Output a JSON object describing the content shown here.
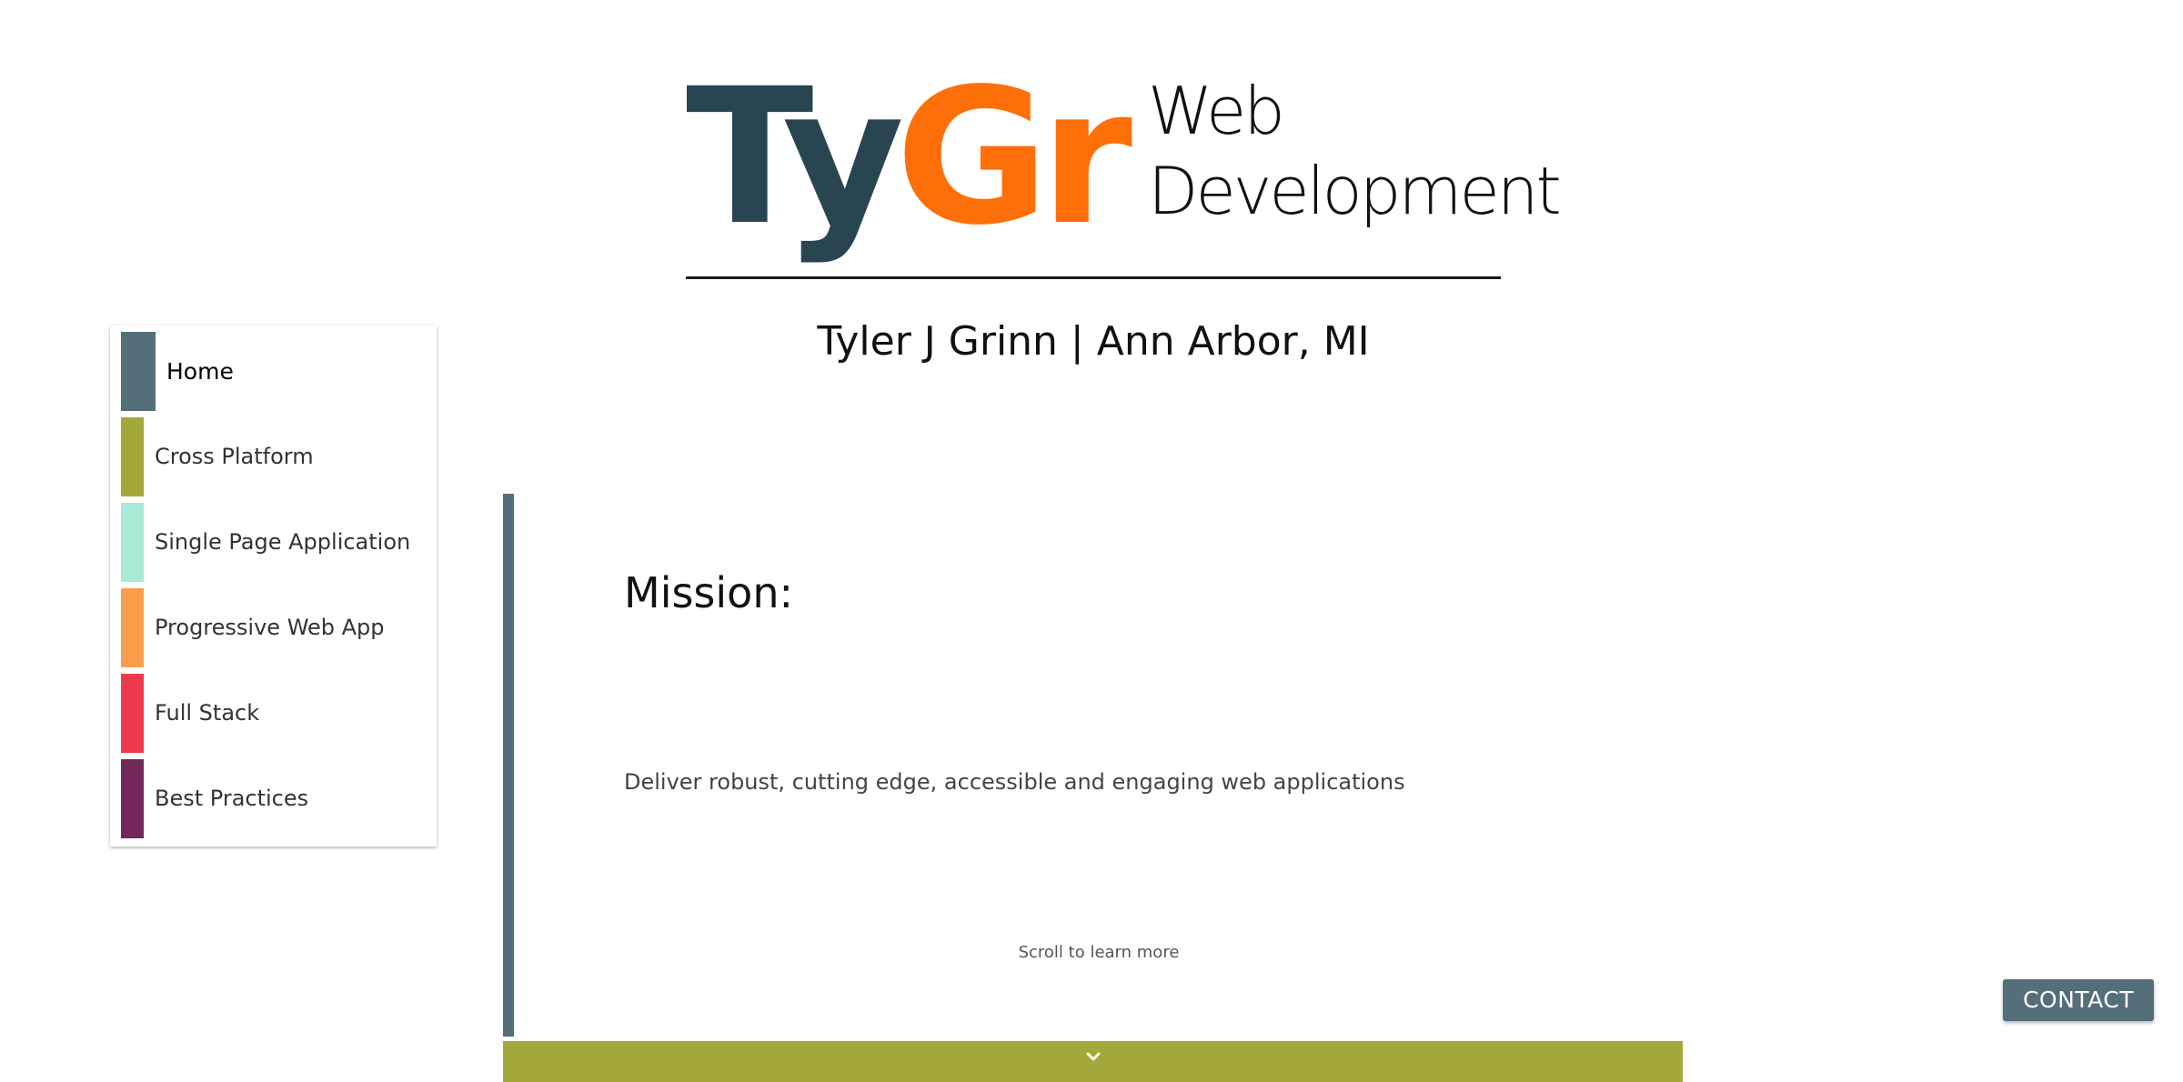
{
  "header": {
    "logo_part1": "Ty",
    "logo_part2": "Gr",
    "tagline_line1": "Web",
    "tagline_line2": "Development",
    "byline": "Tyler J Grinn | Ann Arbor, MI"
  },
  "nav": {
    "items": [
      {
        "label": "Home",
        "color": "#546e7a",
        "active": true
      },
      {
        "label": "Cross Platform",
        "color": "#a4a83a",
        "active": false
      },
      {
        "label": "Single Page Application",
        "color": "#a8ead5",
        "active": false
      },
      {
        "label": "Progressive Web App",
        "color": "#f89e4b",
        "active": false
      },
      {
        "label": "Full Stack",
        "color": "#ee3a4a",
        "active": false
      },
      {
        "label": "Best Practices",
        "color": "#74285a",
        "active": false
      }
    ]
  },
  "main": {
    "title": "Mission:",
    "text": "Deliver robust, cutting edge, accessible and engaging web applications",
    "scroll_hint": "Scroll to learn more",
    "scroll_icon": "chevron-down-icon",
    "accent_color": "#546e7a",
    "scroll_bar_color": "#a4a83a"
  },
  "contact": {
    "label": "CONTACT",
    "color": "#546e7a"
  },
  "colors": {
    "logo_dark": "#2a4552",
    "logo_orange": "#fe6f09"
  }
}
